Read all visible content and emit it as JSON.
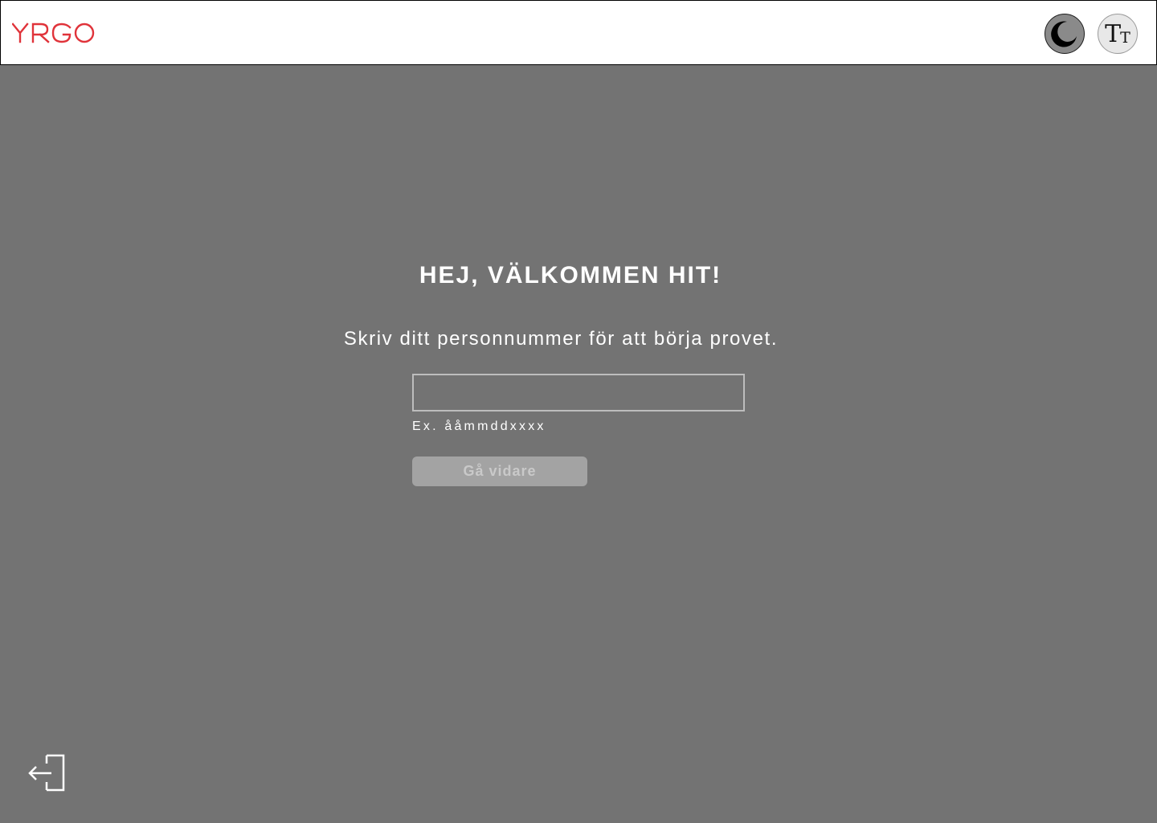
{
  "header": {
    "logo_text": "YRGO",
    "theme_toggle_icon": "moon-icon",
    "text_size_icon": "text-size-icon",
    "text_size_glyph_large": "T",
    "text_size_glyph_small": "T"
  },
  "main": {
    "title": "HEJ, VÄLKOMMEN HIT!",
    "subtitle": "Skriv ditt personnummer för att börja provet.",
    "personnummer_input": {
      "value": "",
      "hint": "Ex. ååmmddxxxx"
    },
    "next_button_label": "Gå vidare"
  },
  "footer": {
    "exit_icon": "logout-icon"
  },
  "colors": {
    "brand": "#e0333a",
    "background": "#737373",
    "header_background": "#ffffff",
    "button_disabled": "#a3a3a3"
  }
}
